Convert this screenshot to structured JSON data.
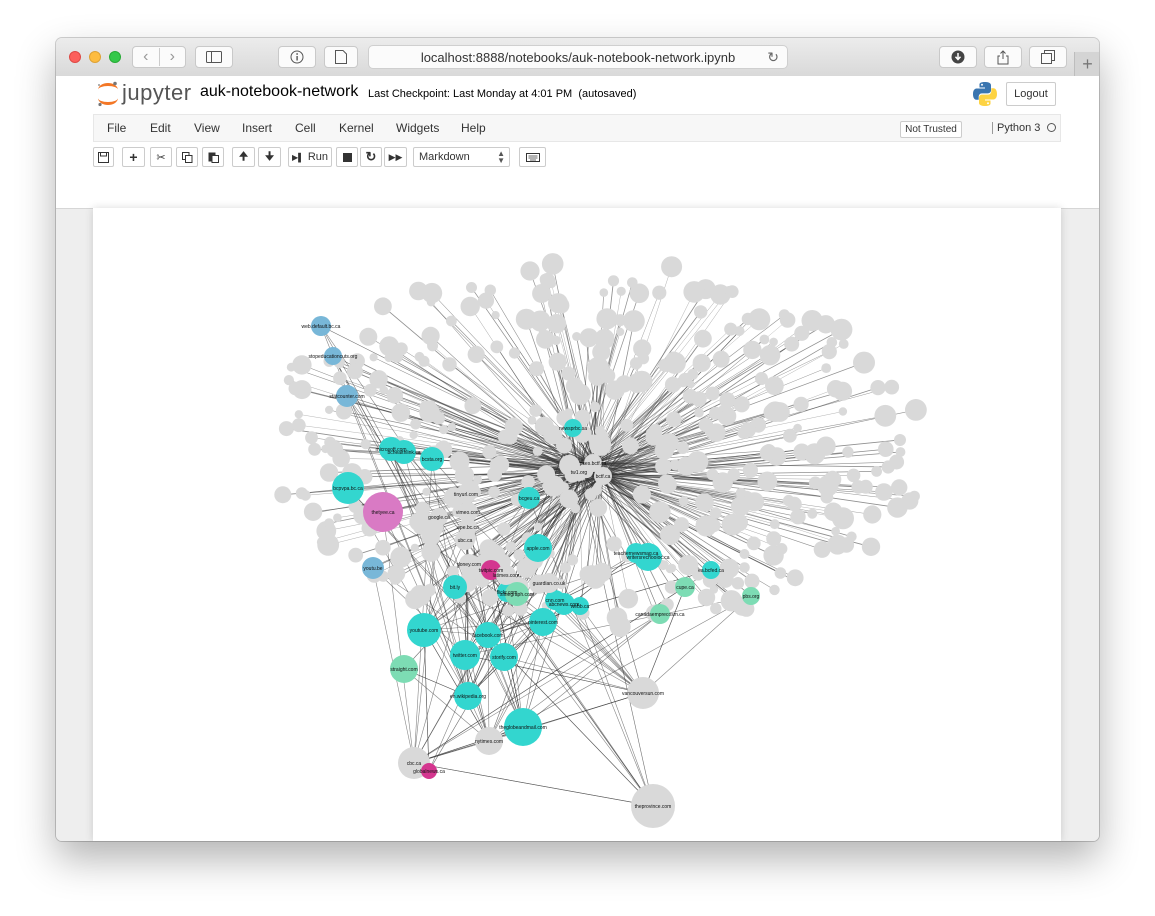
{
  "browser": {
    "url": "localhost:8888/notebooks/auk-notebook-network.ipynb"
  },
  "header": {
    "logo_text": "jupyter",
    "notebook_name": "auk-notebook-network",
    "checkpoint": "Last Checkpoint: Last Monday at 4:01 PM",
    "autosave": "(autosaved)",
    "logout_label": "Logout"
  },
  "menu": [
    "File",
    "Edit",
    "View",
    "Insert",
    "Cell",
    "Kernel",
    "Widgets",
    "Help"
  ],
  "status": {
    "trust": "Not Trusted",
    "kernel": "Python 3"
  },
  "toolbar": {
    "run_label": "Run",
    "cell_type": "Markdown"
  },
  "colors": {
    "node_gray": "#d9d9d9",
    "node_cyan": "#33d6cf",
    "node_blue": "#78b7d8",
    "node_pink": "#d97ac4",
    "node_magenta": "#d4368f",
    "node_mint": "#7ddcb4",
    "edge": "#333333"
  },
  "network": {
    "hubs": [
      "bctf.ca",
      "pses.bctf.ca",
      "tw1.org"
    ],
    "nodes": [
      {
        "label": "bcpvpa.bc.ca",
        "color": "cyan"
      },
      {
        "label": "thetyee.ca",
        "color": "pink"
      },
      {
        "label": "youtu.be",
        "color": "blue"
      },
      {
        "label": "statcounter.com",
        "color": "blue"
      },
      {
        "label": "web.default.bc.ca",
        "color": "blue"
      },
      {
        "label": "stopeducationcuts.org",
        "color": "blue"
      },
      {
        "label": "youtube.com",
        "color": "cyan"
      },
      {
        "label": "twitter.com",
        "color": "cyan"
      },
      {
        "label": "en.wikipedia.org",
        "color": "cyan"
      },
      {
        "label": "theglobeandmail.com",
        "color": "cyan"
      },
      {
        "label": "nytimes.com",
        "color": "gray"
      },
      {
        "label": "cbc.ca",
        "color": "gray"
      },
      {
        "label": "globalnews.ca",
        "color": "magenta"
      },
      {
        "label": "storify.com",
        "color": "cyan"
      },
      {
        "label": "facebook.com",
        "color": "cyan"
      },
      {
        "label": "bit.ly",
        "color": "cyan"
      },
      {
        "label": "apple.com",
        "color": "cyan"
      },
      {
        "label": "abcnews.com",
        "color": "cyan"
      },
      {
        "label": "pinterest.com",
        "color": "cyan"
      },
      {
        "label": "flickr.com",
        "color": "cyan"
      },
      {
        "label": "cnn.com",
        "color": "cyan"
      },
      {
        "label": "webb.ca",
        "color": "cyan"
      },
      {
        "label": "writersrechooloc.ca",
        "color": "cyan"
      },
      {
        "label": "vancouversun.com",
        "color": "gray"
      },
      {
        "label": "slinegraph.com",
        "color": "mint"
      },
      {
        "label": "straight.com",
        "color": "mint"
      },
      {
        "label": "cupe.ca",
        "color": "mint"
      },
      {
        "label": "canadaemprecosm.ca",
        "color": "mint"
      },
      {
        "label": "pbs.org",
        "color": "mint"
      },
      {
        "label": "theprovince.com",
        "color": "gray"
      },
      {
        "label": "microsoft.com",
        "color": "cyan"
      },
      {
        "label": "google.ca",
        "color": "gray"
      },
      {
        "label": "twitpic.com",
        "color": "magenta"
      },
      {
        "label": "bchealthlink.ca",
        "color": "cyan"
      },
      {
        "label": "newsprbc.sa",
        "color": "cyan"
      },
      {
        "label": "ubc.ca",
        "color": "gray"
      },
      {
        "label": "vimeo.com",
        "color": "gray"
      },
      {
        "label": "tinyurl.com",
        "color": "gray"
      },
      {
        "label": "doney.com",
        "color": "gray"
      },
      {
        "label": "latimes.com",
        "color": "gray"
      },
      {
        "label": "guardian.co.uk",
        "color": "gray"
      },
      {
        "label": "bcgeu.ca",
        "color": "cyan"
      },
      {
        "label": "teachernewsmag.ca",
        "color": "cyan"
      },
      {
        "label": "ea.bcfed.ca",
        "color": "cyan"
      },
      {
        "label": "bcsta.org",
        "color": "cyan"
      },
      {
        "label": "ope.bc.ca",
        "color": "gray"
      }
    ]
  }
}
